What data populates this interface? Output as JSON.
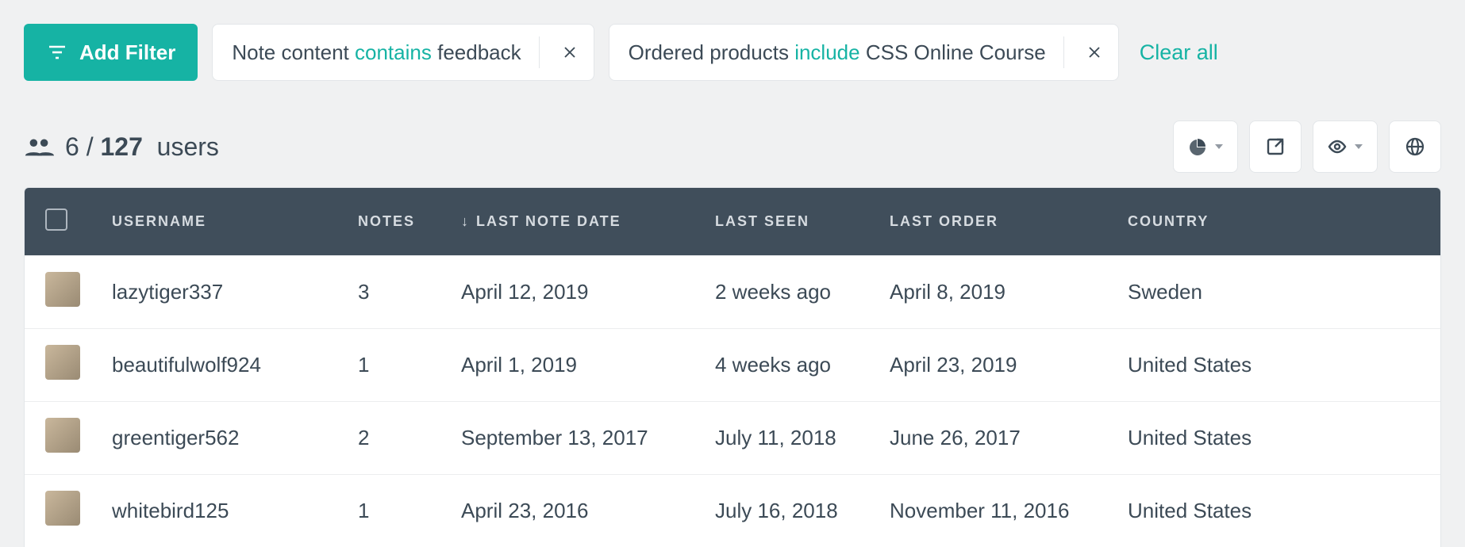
{
  "toolbar": {
    "add_filter_label": "Add Filter",
    "clear_all_label": "Clear all"
  },
  "filters": [
    {
      "field": "Note content",
      "operator": "contains",
      "value": "feedback"
    },
    {
      "field": "Ordered products",
      "operator": "include",
      "value": "CSS Online Course"
    }
  ],
  "count": {
    "filtered": "6",
    "sep": " / ",
    "total": "127",
    "entity": "users"
  },
  "columns": {
    "username": "USERNAME",
    "notes": "NOTES",
    "last_note_date": "LAST NOTE DATE",
    "last_seen": "LAST SEEN",
    "last_order": "LAST ORDER",
    "country": "COUNTRY",
    "sort_indicator": "↓"
  },
  "rows": [
    {
      "username": "lazytiger337",
      "notes": "3",
      "last_note_date": "April 12, 2019",
      "last_seen": "2 weeks ago",
      "last_order": "April 8, 2019",
      "country": "Sweden"
    },
    {
      "username": "beautifulwolf924",
      "notes": "1",
      "last_note_date": "April 1, 2019",
      "last_seen": "4 weeks ago",
      "last_order": "April 23, 2019",
      "country": "United States"
    },
    {
      "username": "greentiger562",
      "notes": "2",
      "last_note_date": "September 13, 2017",
      "last_seen": "July 11, 2018",
      "last_order": "June 26, 2017",
      "country": "United States"
    },
    {
      "username": "whitebird125",
      "notes": "1",
      "last_note_date": "April 23, 2016",
      "last_seen": "July 16, 2018",
      "last_order": "November 11, 2016",
      "country": "United States"
    }
  ]
}
